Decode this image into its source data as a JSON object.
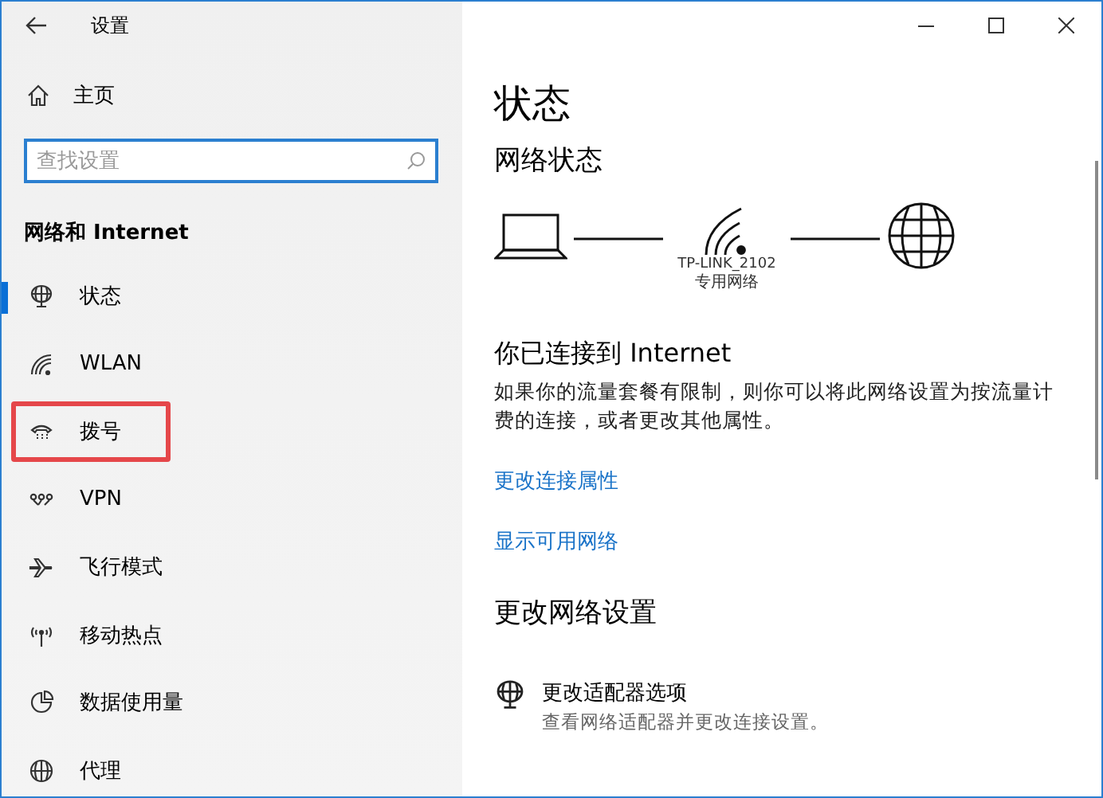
{
  "window": {
    "title": "设置"
  },
  "sidebar": {
    "home": "主页",
    "search": {
      "placeholder": "查找设置"
    },
    "section": "网络和 Internet",
    "items": [
      {
        "label": "状态",
        "kind": "globe-stand",
        "selected": true,
        "highlighted": false
      },
      {
        "label": "WLAN",
        "kind": "wifi",
        "selected": false,
        "highlighted": false
      },
      {
        "label": "拨号",
        "kind": "phone",
        "selected": false,
        "highlighted": true
      },
      {
        "label": "VPN",
        "kind": "vpn",
        "selected": false,
        "highlighted": false
      },
      {
        "label": "飞行模式",
        "kind": "plane",
        "selected": false,
        "highlighted": false
      },
      {
        "label": "移动热点",
        "kind": "hotspot",
        "selected": false,
        "highlighted": false
      },
      {
        "label": "数据使用量",
        "kind": "pie",
        "selected": false,
        "highlighted": false
      },
      {
        "label": "代理",
        "kind": "globe",
        "selected": false,
        "highlighted": false
      }
    ]
  },
  "content": {
    "title": "状态",
    "network_heading": "网络状态",
    "network": {
      "name": "TP-LINK_2102",
      "type": "专用网络"
    },
    "connected": "你已连接到 Internet",
    "description": "如果你的流量套餐有限制，则你可以将此网络设置为按流量计费的连接，或者更改其他属性。",
    "links": [
      "更改连接属性",
      "显示可用网络"
    ],
    "change_heading": "更改网络设置",
    "options": [
      {
        "title": "更改适配器选项",
        "subtitle": "查看网络适配器并更改连接设置。"
      }
    ]
  }
}
